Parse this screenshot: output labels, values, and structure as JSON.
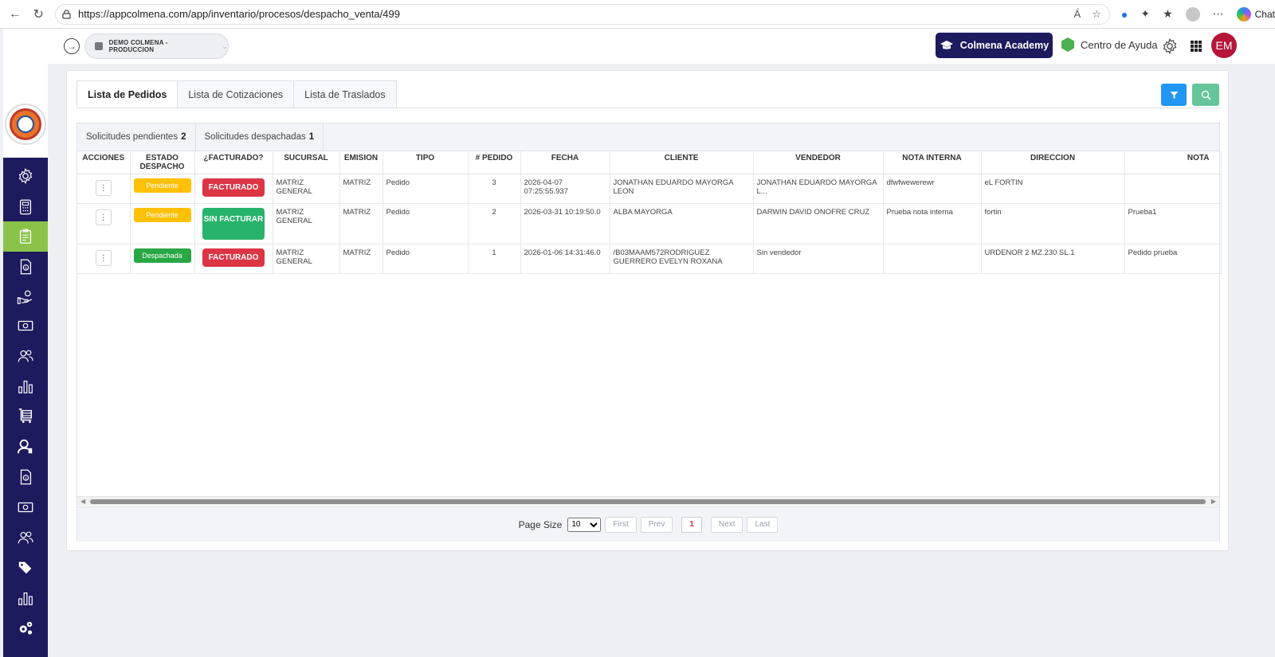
{
  "browser": {
    "url": "https://appcolmena.com/app/inventario/procesos/despacho_venta/499",
    "chat_label": "Chat"
  },
  "header": {
    "company": "DEMO COLMENA - PRODUCCION",
    "academy_label": "Colmena Academy",
    "help_label": "Centro de Ayuda",
    "avatar_initials": "EM"
  },
  "tabs": [
    {
      "label": "Lista de Pedidos",
      "active": true
    },
    {
      "label": "Lista de Cotizaciones",
      "active": false
    },
    {
      "label": "Lista de Traslados",
      "active": false
    }
  ],
  "subtabs": [
    {
      "label": "Solicitudes pendientes",
      "count": "2"
    },
    {
      "label": "Solicitudes despachadas",
      "count": "1"
    }
  ],
  "table": {
    "columns": [
      "ACCIONES",
      "ESTADO DESPACHO",
      "¿FACTURADO?",
      "SUCURSAL",
      "EMISION",
      "TIPO",
      "# PEDIDO",
      "FECHA",
      "CLIENTE",
      "VENDEDOR",
      "NOTA INTERNA",
      "DIRECCION",
      "NOTA"
    ],
    "rows": [
      {
        "estado": "Pendiente",
        "facturado": "FACTURADO",
        "sucursal": "MATRIZ GENERAL",
        "emision": "MATRIZ",
        "tipo": "Pedido",
        "pedido": "3",
        "fecha": "2026-04-07 07:25:55.937",
        "cliente": "JONATHAN EDUARDO MAYORGA LEON",
        "vendedor": "JONATHAN EDUARDO MAYORGA L...",
        "nota_interna": "dfwfwewerewr",
        "direccion": "eL FORTIN",
        "nota": ""
      },
      {
        "estado": "Pendiente",
        "facturado": "SIN FACTURAR",
        "sucursal": "MATRIZ GENERAL",
        "emision": "MATRIZ",
        "tipo": "Pedido",
        "pedido": "2",
        "fecha": "2026-03-31 10:19:50.0",
        "cliente": "ALBA MAYORGA",
        "vendedor": "DARWIN DAVID ONOFRE CRUZ",
        "nota_interna": "Prueba nota interna",
        "direccion": "fortin",
        "nota": "Prueba1"
      },
      {
        "estado": "Despachada",
        "facturado": "FACTURADO",
        "sucursal": "MATRIZ GENERAL",
        "emision": "MATRIZ",
        "tipo": "Pedido",
        "pedido": "1",
        "fecha": "2026-01-06 14:31:46.0",
        "cliente": "/B03MAAM572RODRIGUEZ GUERRERO EVELYN ROXANA",
        "vendedor": "Sin vendedor",
        "nota_interna": "",
        "direccion": "URDENOR 2 MZ.230 SL.1",
        "nota": "Pedido prueba"
      }
    ]
  },
  "pager": {
    "page_size_label": "Page Size",
    "page_size": "10",
    "first": "First",
    "prev": "Prev",
    "current": "1",
    "next": "Next",
    "last": "Last"
  },
  "sidebar": {
    "icons": [
      "gear-icon",
      "calculator-icon",
      "clipboard-list-icon",
      "invoice-icon",
      "hand-coins-icon",
      "cash-icon",
      "users-icon",
      "bar-chart-icon",
      "cart-icon",
      "user-admin-icon",
      "invoice-icon",
      "cash-icon",
      "users-icon",
      "tags-icon",
      "bar-chart-icon",
      "cogs-icon"
    ],
    "active_index": 2
  },
  "colors": {
    "sidebar": "#1d1b5e",
    "active": "#8bc34a",
    "pendiente": "#ffc107",
    "despachada": "#28a745",
    "facturado": "#dc3545",
    "sin_facturar": "#27b36b",
    "filter_btn": "#2196f3",
    "search_btn": "#66c59a",
    "avatar": "#b5163a"
  }
}
